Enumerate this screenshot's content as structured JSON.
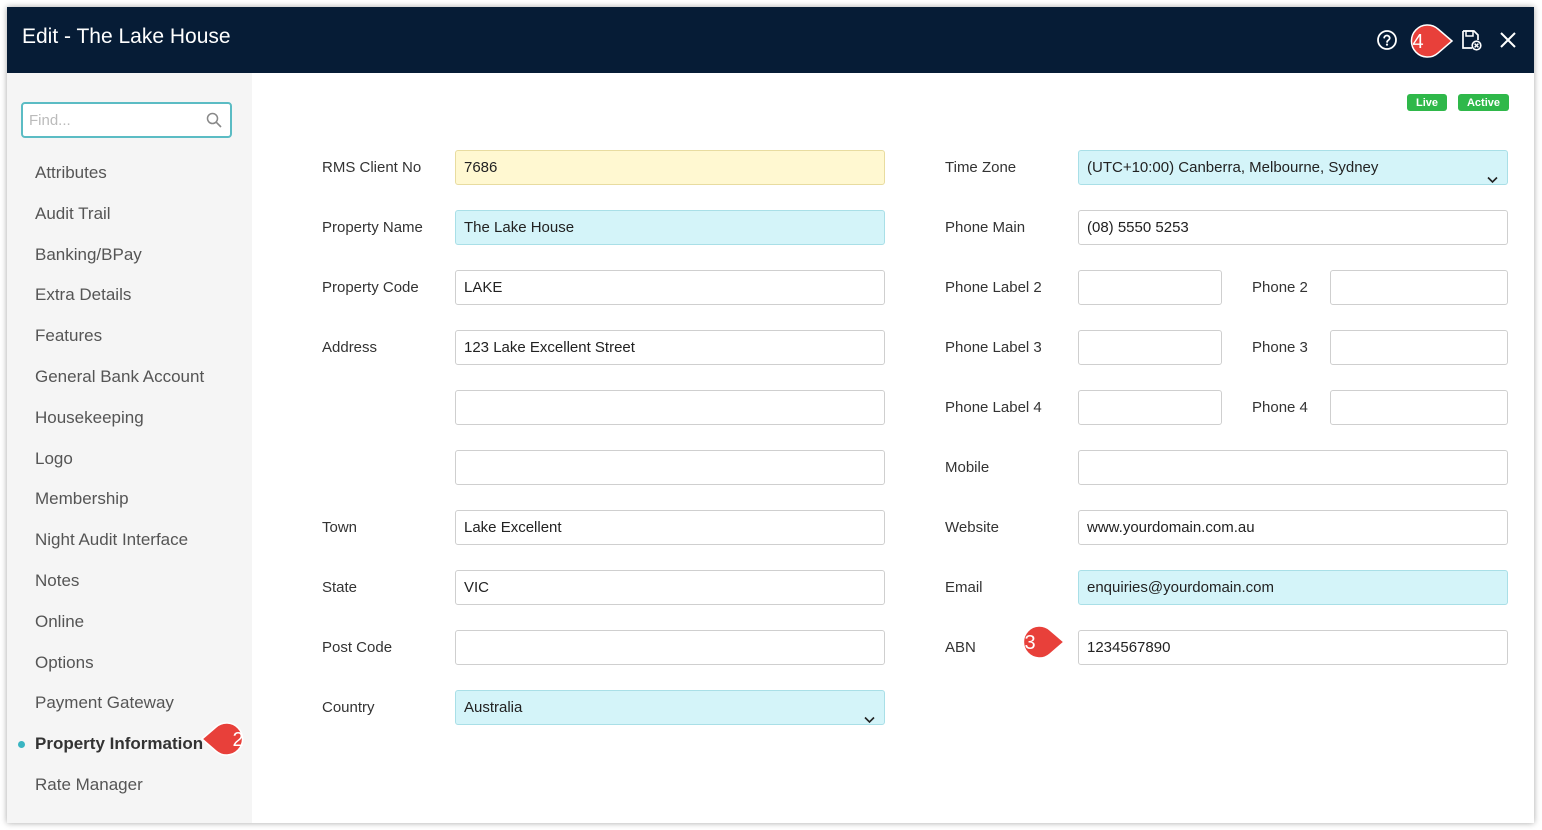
{
  "window": {
    "title": "Edit - The Lake House"
  },
  "header_icons": {
    "help": "help-circle-icon",
    "save_close": "save-close-icon",
    "close": "close-icon"
  },
  "sidebar": {
    "find_placeholder": "Find...",
    "items": [
      {
        "label": "Attributes",
        "active": false
      },
      {
        "label": "Audit Trail",
        "active": false
      },
      {
        "label": "Banking/BPay",
        "active": false
      },
      {
        "label": "Extra Details",
        "active": false
      },
      {
        "label": "Features",
        "active": false
      },
      {
        "label": "General Bank Account",
        "active": false
      },
      {
        "label": "Housekeeping",
        "active": false
      },
      {
        "label": "Logo",
        "active": false
      },
      {
        "label": "Membership",
        "active": false
      },
      {
        "label": "Night Audit Interface",
        "active": false
      },
      {
        "label": "Notes",
        "active": false
      },
      {
        "label": "Online",
        "active": false
      },
      {
        "label": "Options",
        "active": false
      },
      {
        "label": "Payment Gateway",
        "active": false
      },
      {
        "label": "Property Information",
        "active": true
      },
      {
        "label": "Rate Manager",
        "active": false
      }
    ]
  },
  "status": {
    "live": "Live",
    "active": "Active"
  },
  "form_left": {
    "rms_client_no": {
      "label": "RMS Client No",
      "value": "7686"
    },
    "property_name": {
      "label": "Property Name",
      "value": "The Lake House"
    },
    "property_code": {
      "label": "Property Code",
      "value": "LAKE"
    },
    "address": {
      "label": "Address",
      "line1": "123 Lake Excellent Street",
      "line2": "",
      "line3": ""
    },
    "town": {
      "label": "Town",
      "value": "Lake Excellent"
    },
    "state": {
      "label": "State",
      "value": "VIC"
    },
    "post_code": {
      "label": "Post Code",
      "value": ""
    },
    "country": {
      "label": "Country",
      "value": "Australia"
    }
  },
  "form_right": {
    "time_zone": {
      "label": "Time Zone",
      "value": "(UTC+10:00) Canberra, Melbourne, Sydney"
    },
    "phone_main": {
      "label": "Phone Main",
      "value": "(08) 5550 5253"
    },
    "phone_label_2": {
      "label": "Phone Label 2",
      "value": ""
    },
    "phone_2": {
      "label": "Phone 2",
      "value": ""
    },
    "phone_label_3": {
      "label": "Phone Label 3",
      "value": ""
    },
    "phone_3": {
      "label": "Phone 3",
      "value": ""
    },
    "phone_label_4": {
      "label": "Phone Label 4",
      "value": ""
    },
    "phone_4": {
      "label": "Phone 4",
      "value": ""
    },
    "mobile": {
      "label": "Mobile",
      "value": ""
    },
    "website": {
      "label": "Website",
      "value": "www.yourdomain.com.au"
    },
    "email": {
      "label": "Email",
      "value": "enquiries@yourdomain.com"
    },
    "abn": {
      "label": "ABN",
      "value": "1234567890"
    }
  },
  "callouts": {
    "c2": "2",
    "c3": "3",
    "c4": "4"
  },
  "colors": {
    "titlebar": "#061c36",
    "accent": "#3ab5c2",
    "badge": "#2fb84a",
    "callout": "#e8403a"
  }
}
